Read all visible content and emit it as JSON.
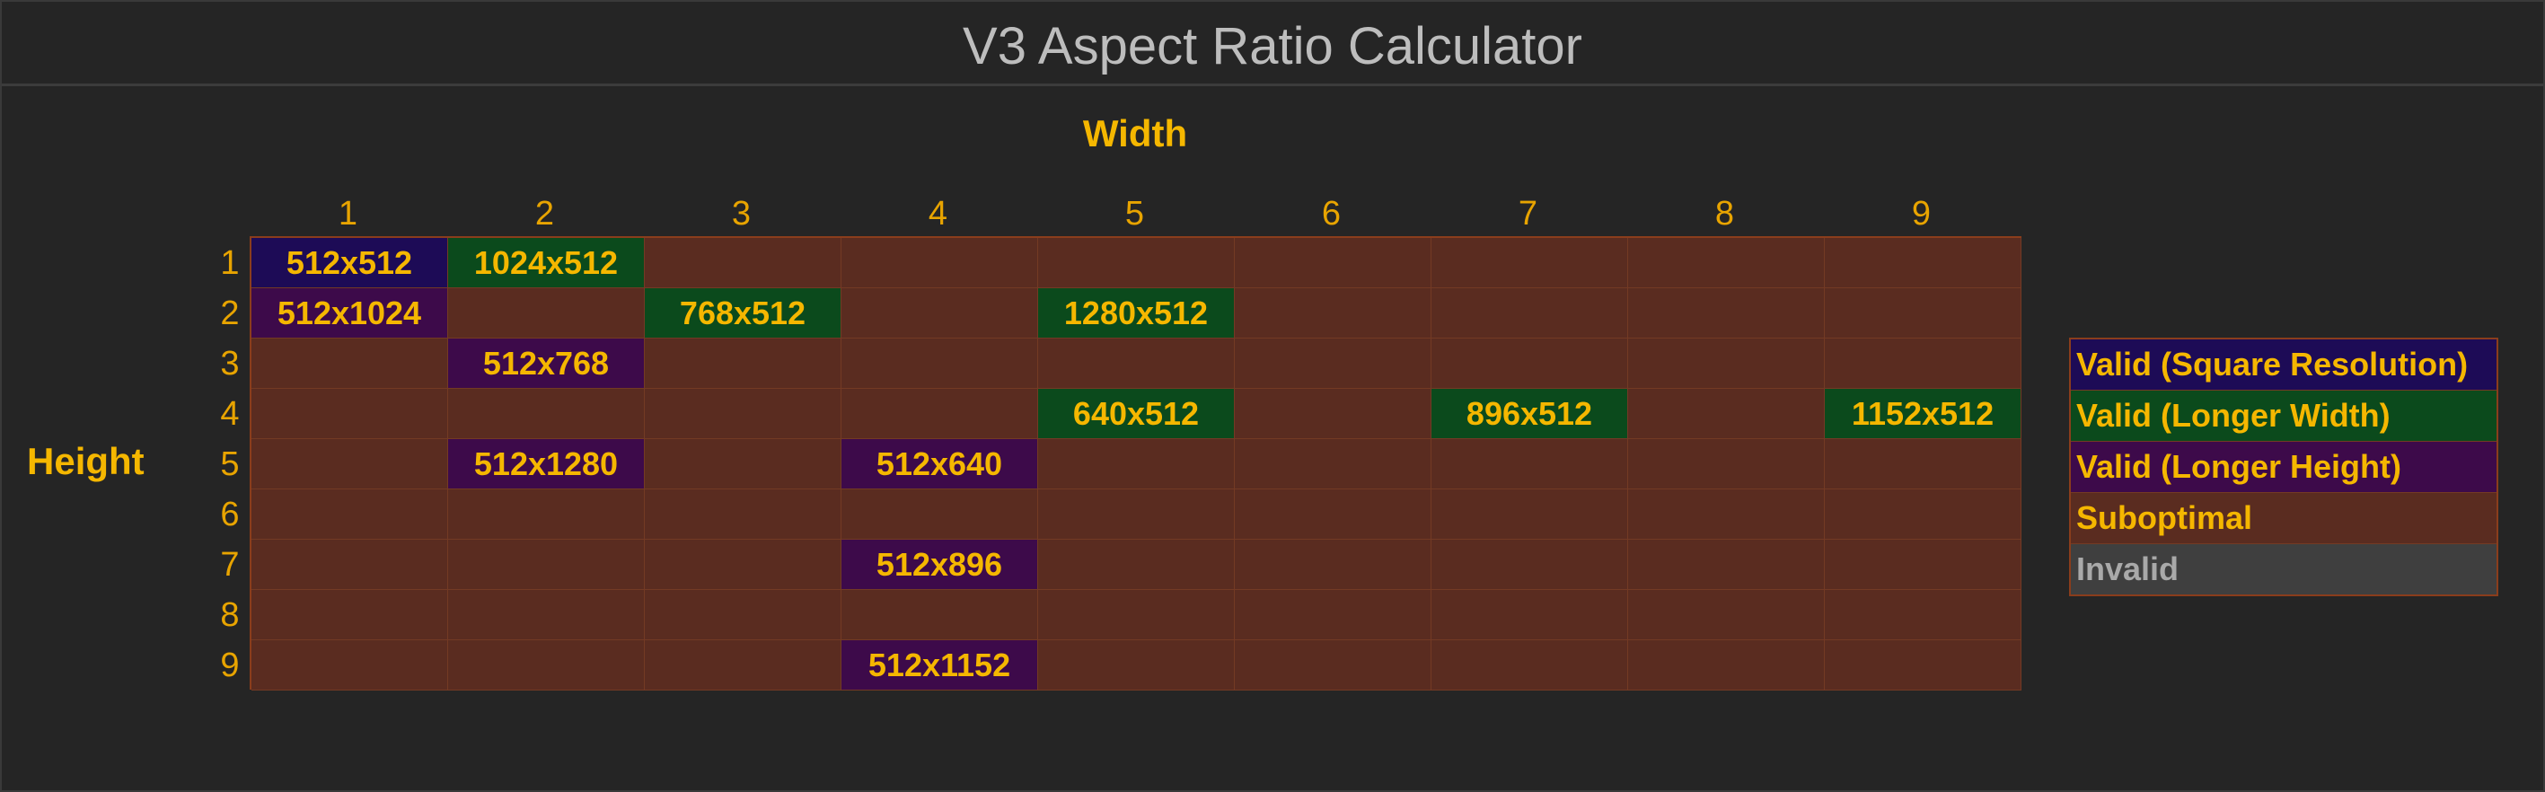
{
  "title": "V3 Aspect Ratio Calculator",
  "width_label": "Width",
  "height_label": "Height",
  "columns": [
    "1",
    "2",
    "3",
    "4",
    "5",
    "6",
    "7",
    "8",
    "9"
  ],
  "rows": [
    "1",
    "2",
    "3",
    "4",
    "5",
    "6",
    "7",
    "8",
    "9"
  ],
  "cells": [
    {
      "row": 1,
      "col": 1,
      "text": "512x512",
      "type": "square"
    },
    {
      "row": 1,
      "col": 2,
      "text": "1024x512",
      "type": "width"
    },
    {
      "row": 2,
      "col": 1,
      "text": "512x1024",
      "type": "height"
    },
    {
      "row": 2,
      "col": 3,
      "text": "768x512",
      "type": "width"
    },
    {
      "row": 2,
      "col": 5,
      "text": "1280x512",
      "type": "width"
    },
    {
      "row": 3,
      "col": 2,
      "text": "512x768",
      "type": "height"
    },
    {
      "row": 4,
      "col": 5,
      "text": "640x512",
      "type": "width"
    },
    {
      "row": 4,
      "col": 7,
      "text": "896x512",
      "type": "width"
    },
    {
      "row": 4,
      "col": 9,
      "text": "1152x512",
      "type": "width"
    },
    {
      "row": 5,
      "col": 2,
      "text": "512x1280",
      "type": "height"
    },
    {
      "row": 5,
      "col": 4,
      "text": "512x640",
      "type": "height"
    },
    {
      "row": 7,
      "col": 4,
      "text": "512x896",
      "type": "height"
    },
    {
      "row": 9,
      "col": 4,
      "text": "512x1152",
      "type": "height"
    }
  ],
  "legend": [
    {
      "label": "Valid (Square Resolution)",
      "type": "square"
    },
    {
      "label": "Valid (Longer Width)",
      "type": "width"
    },
    {
      "label": "Valid (Longer Height)",
      "type": "height"
    },
    {
      "label": "Suboptimal",
      "type": "subopt"
    },
    {
      "label": "Invalid",
      "type": "invalid"
    }
  ],
  "colors": {
    "background": "#252525",
    "text_accent": "#f5b700",
    "square": "#1d0b56",
    "longer_width": "#0b4a1c",
    "longer_height": "#3d0a4a",
    "suboptimal": "#5a2c20",
    "invalid": "#3f3f3f"
  }
}
